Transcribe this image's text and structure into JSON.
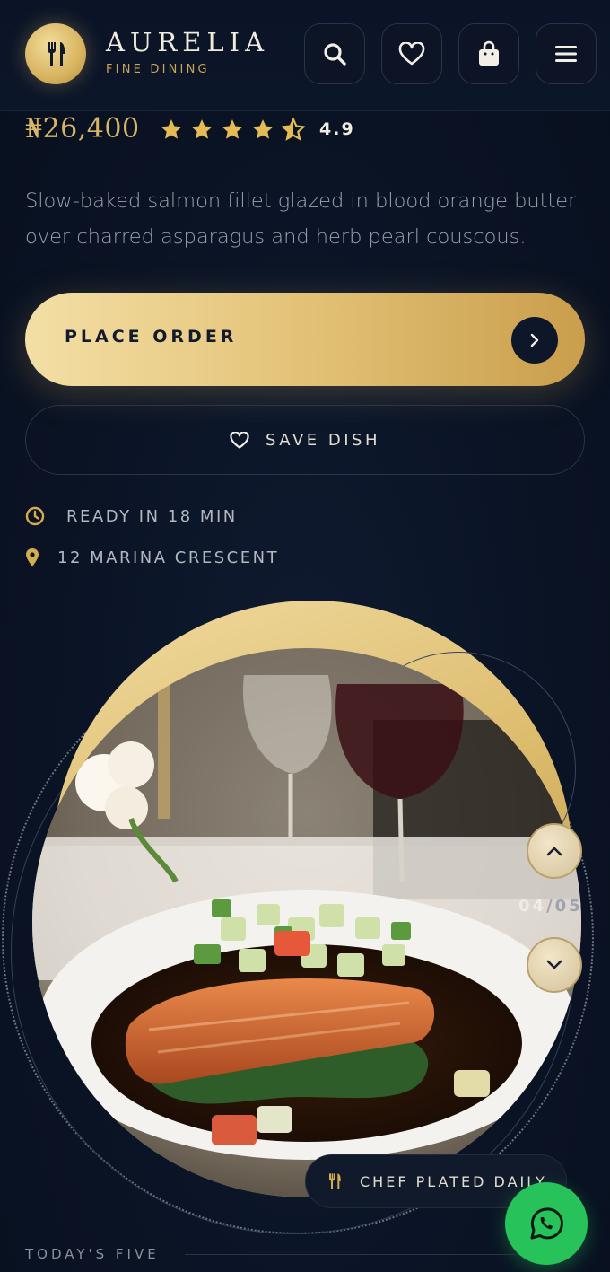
{
  "header": {
    "brand_name": "AURELIA",
    "brand_tag": "FINE DINING",
    "logo_icon": "cutlery-icon",
    "actions": [
      {
        "name": "search-button",
        "icon": "search-icon"
      },
      {
        "name": "favorites-button",
        "icon": "heart-icon"
      },
      {
        "name": "cart-button",
        "icon": "shopping-bag-icon"
      },
      {
        "name": "menu-button",
        "icon": "hamburger-icon"
      }
    ]
  },
  "dish": {
    "price": "₦26,400",
    "rating_stars": 4.5,
    "rating": "4.9",
    "description": "Slow-baked salmon fillet glazed in blood orange butter over charred asparagus and herb pearl couscous."
  },
  "actions": {
    "order_label": "PLACE ORDER",
    "save_label": "SAVE DISH"
  },
  "meta": {
    "ready_time": "READY IN 18 MIN",
    "location": "12 MARINA CRESCENT"
  },
  "carousel": {
    "counter_current": "04",
    "counter_separator": "/",
    "counter_total": "05"
  },
  "badge": {
    "chef_label": "CHEF PLATED DAILY"
  },
  "section": {
    "today_label": "TODAY'S FIVE"
  },
  "colors": {
    "background": "#0b1527",
    "gold": "#d9b566",
    "whatsapp": "#27c25a"
  }
}
